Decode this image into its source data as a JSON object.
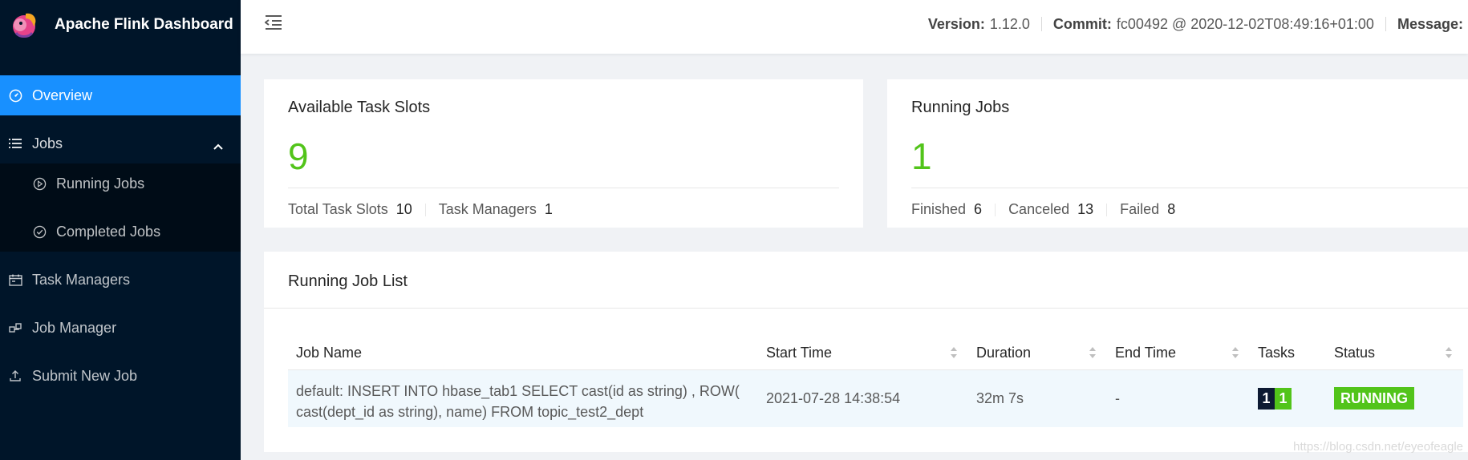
{
  "app": {
    "title": "Apache Flink Dashboard"
  },
  "sidebar": {
    "items": [
      {
        "label": "Overview",
        "icon": "dashboard-icon",
        "active": true
      },
      {
        "label": "Jobs",
        "icon": "list-icon",
        "expanded": true,
        "children": [
          {
            "label": "Running Jobs",
            "icon": "play-circle-icon"
          },
          {
            "label": "Completed Jobs",
            "icon": "check-circle-icon"
          }
        ]
      },
      {
        "label": "Task Managers",
        "icon": "schedule-icon"
      },
      {
        "label": "Job Manager",
        "icon": "build-icon"
      },
      {
        "label": "Submit New Job",
        "icon": "upload-icon"
      }
    ]
  },
  "header": {
    "version_label": "Version:",
    "version_value": "1.12.0",
    "commit_label": "Commit:",
    "commit_value": "fc00492 @ 2020-12-02T08:49:16+01:00",
    "message_label": "Message:"
  },
  "slots_card": {
    "title": "Available Task Slots",
    "value": "9",
    "total_label": "Total Task Slots",
    "total_value": "10",
    "tm_label": "Task Managers",
    "tm_value": "1"
  },
  "jobs_card": {
    "title": "Running Jobs",
    "value": "1",
    "finished_label": "Finished",
    "finished_value": "6",
    "canceled_label": "Canceled",
    "canceled_value": "13",
    "failed_label": "Failed",
    "failed_value": "8"
  },
  "job_list": {
    "title": "Running Job List",
    "columns": [
      "Job Name",
      "Start Time",
      "Duration",
      "End Time",
      "Tasks",
      "Status"
    ],
    "rows": [
      {
        "name_line1": "default: INSERT INTO hbase_tab1 SELECT cast(id as string) , ROW(",
        "name_line2": "cast(dept_id as string), name) FROM topic_test2_dept",
        "start_time": "2021-07-28 14:38:54",
        "duration": "32m 7s",
        "end_time": "-",
        "tasks_total": "1",
        "tasks_running": "1",
        "status": "RUNNING"
      }
    ]
  },
  "colors": {
    "sider": "#001529",
    "active": "#1890ff",
    "success": "#52c41a",
    "badge_dark": "#0d1a33"
  },
  "watermark": "https://blog.csdn.net/eyeofeagle"
}
